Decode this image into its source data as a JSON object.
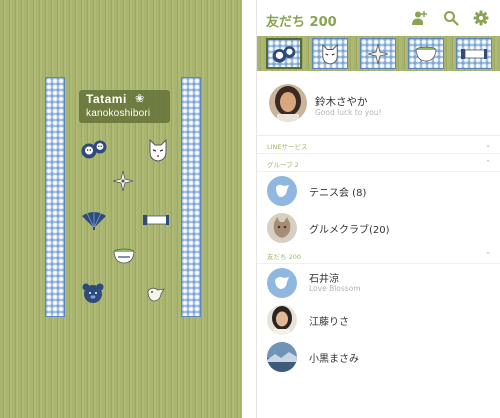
{
  "preview": {
    "title": "Tatami",
    "flower_glyph": "❀",
    "subtitle": "kanokoshibori",
    "icons": [
      "daruma-dolls-icon",
      "kitsune-mask-icon",
      "shuriken-icon",
      "folding-fan-icon",
      "scroll-icon",
      "tea-bowl-icon",
      "bear-face-icon",
      "bird-icon"
    ]
  },
  "header": {
    "title": "友だち 200",
    "buttons": [
      "add-friend-icon",
      "search-icon",
      "settings-icon"
    ]
  },
  "tabs": [
    {
      "icon": "daruma-dolls-icon",
      "active": true
    },
    {
      "icon": "kitsune-mask-icon",
      "active": false
    },
    {
      "icon": "shuriken-icon",
      "active": false
    },
    {
      "icon": "tea-bowl-icon",
      "active": false
    },
    {
      "icon": "scroll-icon",
      "active": false
    }
  ],
  "profile": {
    "name": "鈴木さやか",
    "status": "Good luck to you!"
  },
  "sections": {
    "line_services": "LINEサービス",
    "groups": "グループ 2",
    "friends": "友だち 200"
  },
  "groups": [
    {
      "name": "テニス会 (8)"
    },
    {
      "name": "グルメクラブ(20)"
    }
  ],
  "friends": [
    {
      "name": "石井涼",
      "status": "Love Blossom"
    },
    {
      "name": "江藤りさ",
      "status": ""
    },
    {
      "name": "小黒まさみ",
      "status": ""
    }
  ],
  "colors": {
    "accent": "#8aa352",
    "tatami": "#a8b36c",
    "kanoko_blue": "#7ea4d4",
    "avatar_default": "#8fb7e0"
  }
}
